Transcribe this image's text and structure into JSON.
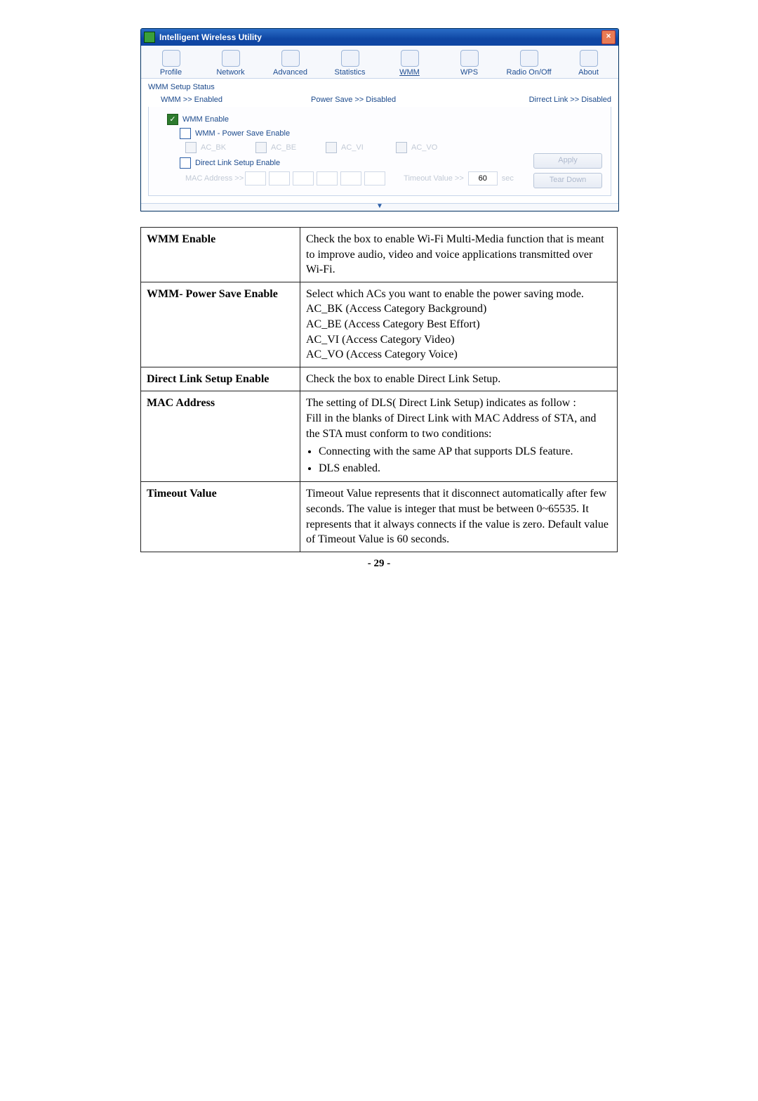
{
  "app": {
    "title": "Intelligent Wireless Utility",
    "close": "×",
    "toolbar": [
      {
        "name": "profile",
        "label": "Profile"
      },
      {
        "name": "network",
        "label": "Network"
      },
      {
        "name": "advanced",
        "label": "Advanced"
      },
      {
        "name": "statistics",
        "label": "Statistics"
      },
      {
        "name": "wmm",
        "label": "WMM"
      },
      {
        "name": "wps",
        "label": "WPS"
      },
      {
        "name": "radio",
        "label": "Radio On/Off"
      },
      {
        "name": "about",
        "label": "About"
      }
    ],
    "status": {
      "section_label": "WMM Setup Status",
      "wmm": "WMM >> Enabled",
      "power_save": "Power Save >> Disabled",
      "direct_link": "Dirrect Link >> Disabled"
    },
    "settings": {
      "wmm_enable": "WMM Enable",
      "pse": "WMM - Power Save Enable",
      "ac_bk": "AC_BK",
      "ac_be": "AC_BE",
      "ac_vi": "AC_VI",
      "ac_vo": "AC_VO",
      "dls_enable": "Direct Link Setup Enable",
      "mac_label": "MAC Address >>",
      "timeout_label": "Timeout Value >>",
      "timeout_value": "60",
      "sec": "sec",
      "apply": "Apply",
      "tear_down": "Tear Down"
    },
    "collapse_glyph": "▼"
  },
  "table": {
    "rows": [
      {
        "key": "WMM Enable",
        "value": "Check the box to enable Wi-Fi Multi-Media function that is meant to improve audio, video and voice applications transmitted over Wi-Fi."
      },
      {
        "key": "WMM- Power Save Enable",
        "value_lines": [
          "Select which ACs you want to enable the power saving mode.",
          "AC_BK (Access Category Background)",
          "AC_BE (Access Category Best Effort)",
          "AC_VI (Access Category Video)",
          "AC_VO (Access Category Voice)"
        ]
      },
      {
        "key": "Direct Link Setup Enable",
        "value": "Check the box to enable Direct Link Setup."
      },
      {
        "key": "MAC Address",
        "value_lines": [
          "The setting of DLS( Direct Link Setup) indicates as follow :",
          "Fill in the blanks of Direct Link with MAC Address of STA, and the STA must conform to two conditions:"
        ],
        "bullets": [
          "Connecting with the same AP that supports DLS feature.",
          "DLS enabled."
        ]
      },
      {
        "key": "Timeout Value",
        "value": "Timeout Value represents that it disconnect automatically after few seconds. The value is integer that must be between 0~65535. It represents that it always connects if the value is zero. Default value of Timeout Value is 60 seconds."
      }
    ]
  },
  "page_number": "- 29 -"
}
